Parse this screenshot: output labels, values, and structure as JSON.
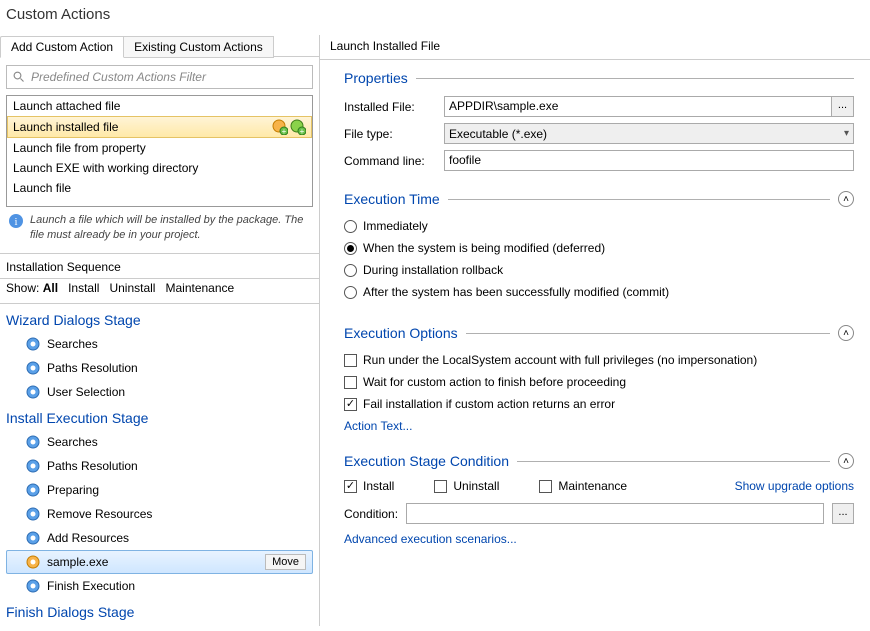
{
  "title": "Custom Actions",
  "tabs": {
    "add": "Add Custom Action",
    "existing": "Existing Custom Actions"
  },
  "filter": {
    "placeholder": "Predefined Custom Actions Filter"
  },
  "action_list": [
    "Launch attached file",
    "Launch installed file",
    "Launch file from property",
    "Launch EXE with working directory",
    "Launch file"
  ],
  "hint": "Launch a file which will be installed by the package. The file must already be in your project.",
  "seq_title": "Installation Sequence",
  "show_row": {
    "label": "Show:",
    "all": "All",
    "install": "Install",
    "uninstall": "Uninstall",
    "maint": "Maintenance"
  },
  "stages": {
    "wizard": {
      "title": "Wizard Dialogs Stage",
      "items": [
        "Searches",
        "Paths Resolution",
        "User Selection"
      ]
    },
    "install": {
      "title": "Install Execution Stage",
      "items": [
        "Searches",
        "Paths Resolution",
        "Preparing",
        "Remove Resources",
        "Add Resources",
        "sample.exe",
        "Finish Execution"
      ],
      "selected_index": 5,
      "move_label": "Move"
    },
    "finish": {
      "title": "Finish Dialogs Stage"
    }
  },
  "right": {
    "heading": "Launch Installed File",
    "properties": {
      "title": "Properties",
      "installed_file_label": "Installed File:",
      "installed_file_value": "APPDIR\\sample.exe",
      "file_type_label": "File type:",
      "file_type_value": "Executable (*.exe)",
      "cmd_label": "Command line:",
      "cmd_value": "foofile"
    },
    "exec_time": {
      "title": "Execution Time",
      "opts": [
        "Immediately",
        "When the system is being modified (deferred)",
        "During installation rollback",
        "After the system has been successfully modified (commit)"
      ],
      "checked_index": 1
    },
    "exec_opts": {
      "title": "Execution Options",
      "opts": [
        "Run under the LocalSystem account with full privileges (no impersonation)",
        "Wait for custom action to finish before proceeding",
        "Fail installation if custom action returns an error"
      ],
      "checked_indices": [
        2
      ],
      "action_text": "Action Text..."
    },
    "exec_stage": {
      "title": "Execution Stage Condition",
      "install": "Install",
      "uninstall": "Uninstall",
      "maintenance": "Maintenance",
      "show_upgrade": "Show upgrade options",
      "condition_label": "Condition:",
      "condition_value": "",
      "adv": "Advanced execution scenarios..."
    }
  }
}
